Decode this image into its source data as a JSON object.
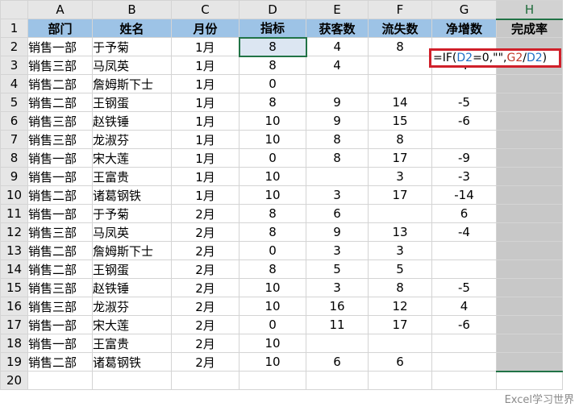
{
  "columns": [
    "A",
    "B",
    "C",
    "D",
    "E",
    "F",
    "G",
    "H"
  ],
  "header_row": [
    "部门",
    "姓名",
    "月份",
    "指标",
    "获客数",
    "流失数",
    "净增数",
    "完成率"
  ],
  "rows": [
    [
      "销售一部",
      "于予菊",
      "1月",
      "8",
      "4",
      "8",
      ""
    ],
    [
      "销售三部",
      "马凤英",
      "1月",
      "8",
      "4",
      "",
      "4"
    ],
    [
      "销售二部",
      "詹姆斯下士",
      "1月",
      "0",
      "",
      "",
      ""
    ],
    [
      "销售二部",
      "王钢蛋",
      "1月",
      "8",
      "9",
      "14",
      "-5"
    ],
    [
      "销售三部",
      "赵铁锤",
      "1月",
      "10",
      "9",
      "15",
      "-6"
    ],
    [
      "销售三部",
      "龙淑芬",
      "1月",
      "10",
      "8",
      "8",
      ""
    ],
    [
      "销售一部",
      "宋大莲",
      "1月",
      "0",
      "8",
      "17",
      "-9"
    ],
    [
      "销售一部",
      "王富贵",
      "1月",
      "10",
      "",
      "3",
      "-3"
    ],
    [
      "销售二部",
      "诸葛钢铁",
      "1月",
      "10",
      "3",
      "17",
      "-14"
    ],
    [
      "销售一部",
      "于予菊",
      "2月",
      "8",
      "6",
      "",
      "6"
    ],
    [
      "销售三部",
      "马凤英",
      "2月",
      "8",
      "9",
      "13",
      "-4"
    ],
    [
      "销售二部",
      "詹姆斯下士",
      "2月",
      "0",
      "3",
      "3",
      ""
    ],
    [
      "销售二部",
      "王钢蛋",
      "2月",
      "8",
      "5",
      "5",
      ""
    ],
    [
      "销售三部",
      "赵铁锤",
      "2月",
      "10",
      "3",
      "8",
      "-5"
    ],
    [
      "销售三部",
      "龙淑芬",
      "2月",
      "10",
      "16",
      "12",
      "4"
    ],
    [
      "销售一部",
      "宋大莲",
      "2月",
      "0",
      "11",
      "17",
      "-6"
    ],
    [
      "销售一部",
      "王富贵",
      "2月",
      "10",
      "",
      "",
      ""
    ],
    [
      "销售二部",
      "诸葛钢铁",
      "2月",
      "10",
      "6",
      "6",
      ""
    ]
  ],
  "formula": {
    "p1": "=IF(",
    "r1": "D2",
    "p2": "=0,\"\",",
    "r2": "G2",
    "p3": "/",
    "r3": "D2",
    "p4": ")"
  },
  "watermark": "Excel学习世界",
  "colors": {
    "header_fill": "#9dc3e6",
    "selection_green": "#217346",
    "highlight_red": "#d0202a",
    "selected_column_fill": "#c8c8c8"
  }
}
